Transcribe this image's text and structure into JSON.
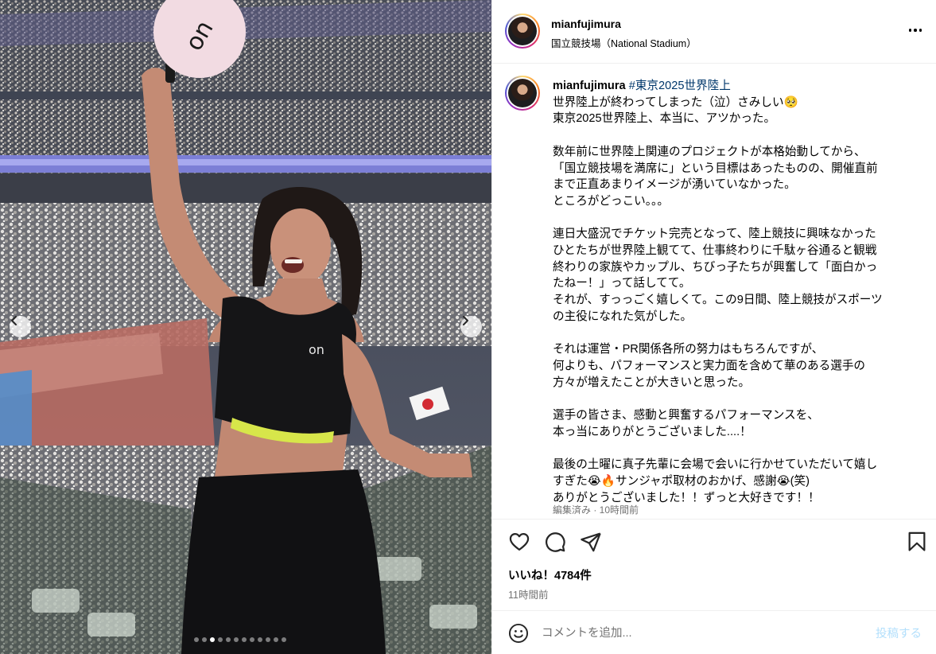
{
  "photo": {
    "alt": "",
    "carousel": {
      "total": 12,
      "active": 2
    }
  },
  "header": {
    "username": "mianfujimura",
    "location": "国立競技場（National Stadium）"
  },
  "caption": {
    "username": "mianfujimura",
    "hashtag": "#東京2025世界陸上",
    "text": "世界陸上が終わってしまった（泣）さみしい🥺\n東京2025世界陸上、本当に、アツかった。\n\n数年前に世界陸上関連のプロジェクトが本格始動してから、\n「国立競技場を満席に」という目標はあったものの、開催直前\nまで正直あまりイメージが湧いていなかった。\nところがどっこい。。。\n\n連日大盛況でチケット完売となって、陸上競技に興味なかった\nひとたちが世界陸上観てて、仕事終わりに千駄ヶ谷通ると観戦\n終わりの家族やカップル、ちびっ子たちが興奮して「面白かっ\nたねー！」って話してて。\nそれが、すっっごく嬉しくて。この9日間、陸上競技がスポーツ\nの主役になれた気がした。\n\nそれは運営・PR関係各所の努力はもちろんですが、\n何よりも、パフォーマンスと実力面を含めて華のある選手の\n方々が増えたことが大きいと思った。\n\n選手の皆さま、感動と興奮するパフォーマンスを、\n本っ当にありがとうございました....！\n\n最後の土曜に真子先輩に会場で会いに行かせていただいて嬉し\nすぎた😭🔥サンジャポ取材のおかげ、感謝😭(笑)\nありがとうございました！！ずっと大好きです！！",
    "meta": "編集済み · 10時間前"
  },
  "actions": {
    "likes": "いいね！4784件",
    "time": "11時間前"
  },
  "comment_box": {
    "placeholder": "コメントを追加...",
    "post_label": "投稿する"
  },
  "colors": {
    "link": "#00376b",
    "muted": "#737373",
    "post_button_disabled": "#b2dffc",
    "divider": "#efefef"
  },
  "icons": [
    "chevron-left-icon",
    "chevron-right-icon",
    "more-icon",
    "heart-icon",
    "comment-icon",
    "share-icon",
    "bookmark-icon",
    "emoji-icon"
  ]
}
